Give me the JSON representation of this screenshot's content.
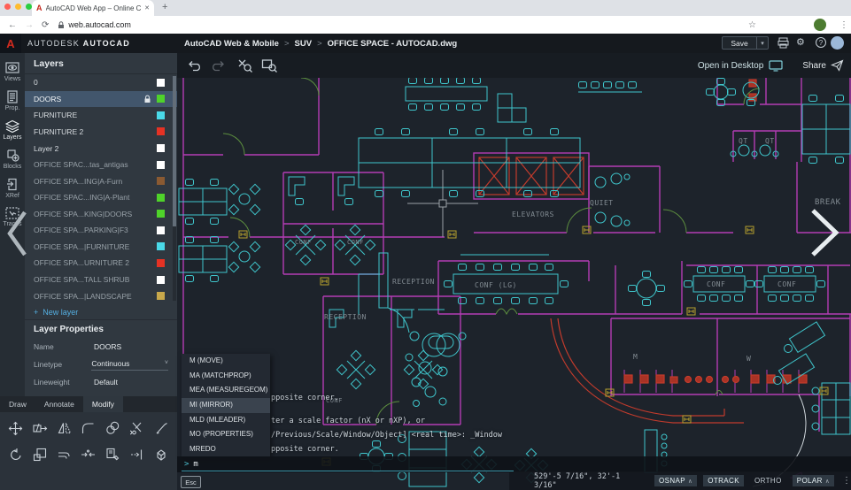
{
  "browser": {
    "tab_title": "AutoCAD Web App – Online CA",
    "url": "web.autocad.com"
  },
  "icons": {
    "close": "✕",
    "new_tab": "+",
    "back": "←",
    "forward": "→",
    "reload": "⟳",
    "star": "☆",
    "kebab": "⋮",
    "caret_down": "▾",
    "chevron_up": "∧",
    "breadcrumb_separator": ">",
    "help": "?",
    "gear": "⚙",
    "plus": "+"
  },
  "header": {
    "brand_primary": "AUTODESK",
    "brand_secondary": "AUTOCAD",
    "breadcrumb": [
      "AutoCAD Web & Mobile",
      "SUV",
      "OFFICE SPACE - AUTOCAD.dwg"
    ],
    "save_label": "Save"
  },
  "rail": {
    "items": [
      {
        "label": "Views"
      },
      {
        "label": "Prop."
      },
      {
        "label": "Layers",
        "active": true
      },
      {
        "label": "Blocks"
      },
      {
        "label": "XRef"
      },
      {
        "label": "Traces"
      }
    ]
  },
  "layers_panel": {
    "title": "Layers",
    "layers": [
      {
        "name": "0",
        "color": "#ffffff"
      },
      {
        "name": "DOORS",
        "color": "#4fd32a",
        "selected": true,
        "locked": true
      },
      {
        "name": "FURNITURE",
        "color": "#4ad9e8"
      },
      {
        "name": "FURNITURE 2",
        "color": "#e53224"
      },
      {
        "name": "Layer 2",
        "color": "#ffffff"
      },
      {
        "name": "OFFICE SPAC...tas_antigas",
        "color": "#ffffff",
        "dim": true
      },
      {
        "name": "OFFICE SPA...ING|A-Furn",
        "color": "#8a5a32",
        "dim": true
      },
      {
        "name": "OFFICE SPAC...ING|A-Plant",
        "color": "#4fd32a",
        "dim": true
      },
      {
        "name": "OFFICE SPA...KING|DOORS",
        "color": "#4fd32a",
        "dim": true
      },
      {
        "name": "OFFICE SPA...PARKING|F3",
        "color": "#ffffff",
        "dim": true
      },
      {
        "name": "OFFICE SPA...|FURNITURE",
        "color": "#4ad9e8",
        "dim": true
      },
      {
        "name": "OFFICE SPA...URNITURE 2",
        "color": "#e53224",
        "dim": true
      },
      {
        "name": "OFFICE SPA...TALL SHRUB",
        "color": "#ffffff",
        "dim": true
      },
      {
        "name": "OFFICE SPA...|LANDSCAPE",
        "color": "#c8a84b",
        "dim": true
      }
    ],
    "new_layer_label": "New layer",
    "properties_title": "Layer Properties",
    "properties": {
      "name_label": "Name",
      "name_value": "DOORS",
      "linetype_label": "Linetype",
      "linetype_value": "Continuous",
      "lineweight_label": "Lineweight",
      "lineweight_value": "Default"
    }
  },
  "ribbon_tabs": [
    {
      "label": "Draw"
    },
    {
      "label": "Annotate"
    },
    {
      "label": "Modify",
      "active": true
    }
  ],
  "canvas_toolbar": {
    "open_in_desktop_label": "Open in Desktop",
    "share_label": "Share"
  },
  "command": {
    "suggestions": [
      {
        "label": "M (MOVE)"
      },
      {
        "label": "MA (MATCHPROP)"
      },
      {
        "label": "MEA (MEASUREGEOM)"
      },
      {
        "label": "MI (MIRROR)",
        "highlighted": true
      },
      {
        "label": "MLD (MLEADER)"
      },
      {
        "label": "MO (PROPERTIES)"
      },
      {
        "label": "MREDO"
      }
    ],
    "history": [
      {
        "text": "pposite corner."
      },
      {
        "text": "ter a scale factor (nX or nXP), or"
      },
      {
        "text": "/Previous/Scale/Window/Object] <real time>: _Window"
      },
      {
        "text": "pposite corner."
      }
    ],
    "prompt": ">",
    "input_value": "m",
    "esc_label": "Esc"
  },
  "status_bar": {
    "coordinates": "529'-5 7/16\", 32'-1 3/16\"",
    "toggles": [
      {
        "label": "OSNAP",
        "active": true,
        "caret": true
      },
      {
        "label": "OTRACK",
        "active": true
      },
      {
        "label": "ORTHO",
        "active": false
      },
      {
        "label": "POLAR",
        "active": true,
        "caret": true
      }
    ]
  },
  "drawing": {
    "labels": {
      "elevators": "ELEVATORS",
      "reception_upper": "RECEPTION",
      "reception_lower": "RECEPTION",
      "conf_lg": "CONF (LG)",
      "conf_a": "CONF",
      "conf_b": "CONF",
      "conf_c": "CONF",
      "conf_d": "CONF",
      "conf_e": "CONF",
      "quiet": "QUIET",
      "qt_1": "QT",
      "qt_2": "QT",
      "break_room": "BREAK",
      "mens": "M",
      "womens": "W"
    },
    "colors": {
      "walls": "#b43cb4",
      "furniture": "#3fc6cc",
      "accent_red": "#c23b2c",
      "doors": "#5d8f3f",
      "markers": "#b8a22e",
      "labels": "#828b92",
      "background": "#1d232b"
    }
  }
}
